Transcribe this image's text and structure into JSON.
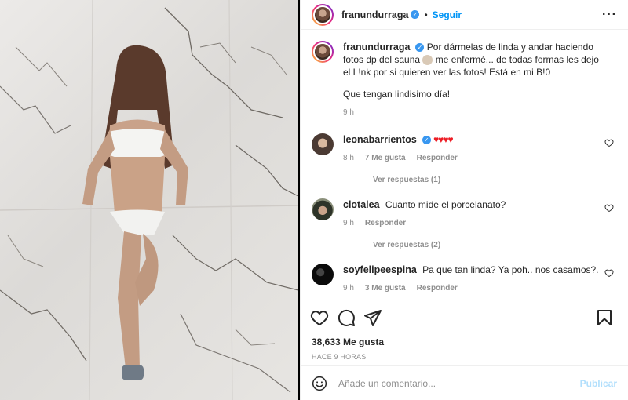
{
  "post": {
    "author": "franundurraga",
    "follow_label": "Seguir",
    "more_label": "···",
    "caption_line": "Por dármelas de linda y andar haciendo fotos dp del sauna",
    "caption_line2": "me enfermé... de todas formas les dejo el L!nk por si quieren ver las fotos! Está en mi B!0",
    "caption_para": "Que tengan lindisimo día!",
    "caption_time": "9 h"
  },
  "comments": [
    {
      "user": "leonabarrientos",
      "verified": true,
      "text": "♥♥♥♥",
      "time": "8 h",
      "likes": "7 Me gusta",
      "reply": "Responder",
      "replies": "Ver respuestas (1)"
    },
    {
      "user": "clotalea",
      "text": "Cuanto mide el porcelanato?",
      "time": "9 h",
      "reply": "Responder",
      "replies": "Ver respuestas (2)"
    },
    {
      "user": "soyfelipeespina",
      "text": "Pa que tan linda? Ya poh.. nos casamos?.",
      "time": "9 h",
      "likes": "3 Me gusta",
      "reply": "Responder"
    }
  ],
  "likes_count": "38,633 Me gusta",
  "posted_ago": "HACE 9 HORAS",
  "composer": {
    "placeholder": "Añade un comentario...",
    "publish_label": "Publicar"
  },
  "colors": {
    "accent": "#0095f6",
    "verified": "#3897f0",
    "publish_disabled": "#b2dffc",
    "heart_emoji": "#ed1c24"
  },
  "icons": [
    "more-icon",
    "heart-icon",
    "comment-icon",
    "share-icon",
    "bookmark-icon",
    "smile-icon",
    "verified-icon"
  ]
}
